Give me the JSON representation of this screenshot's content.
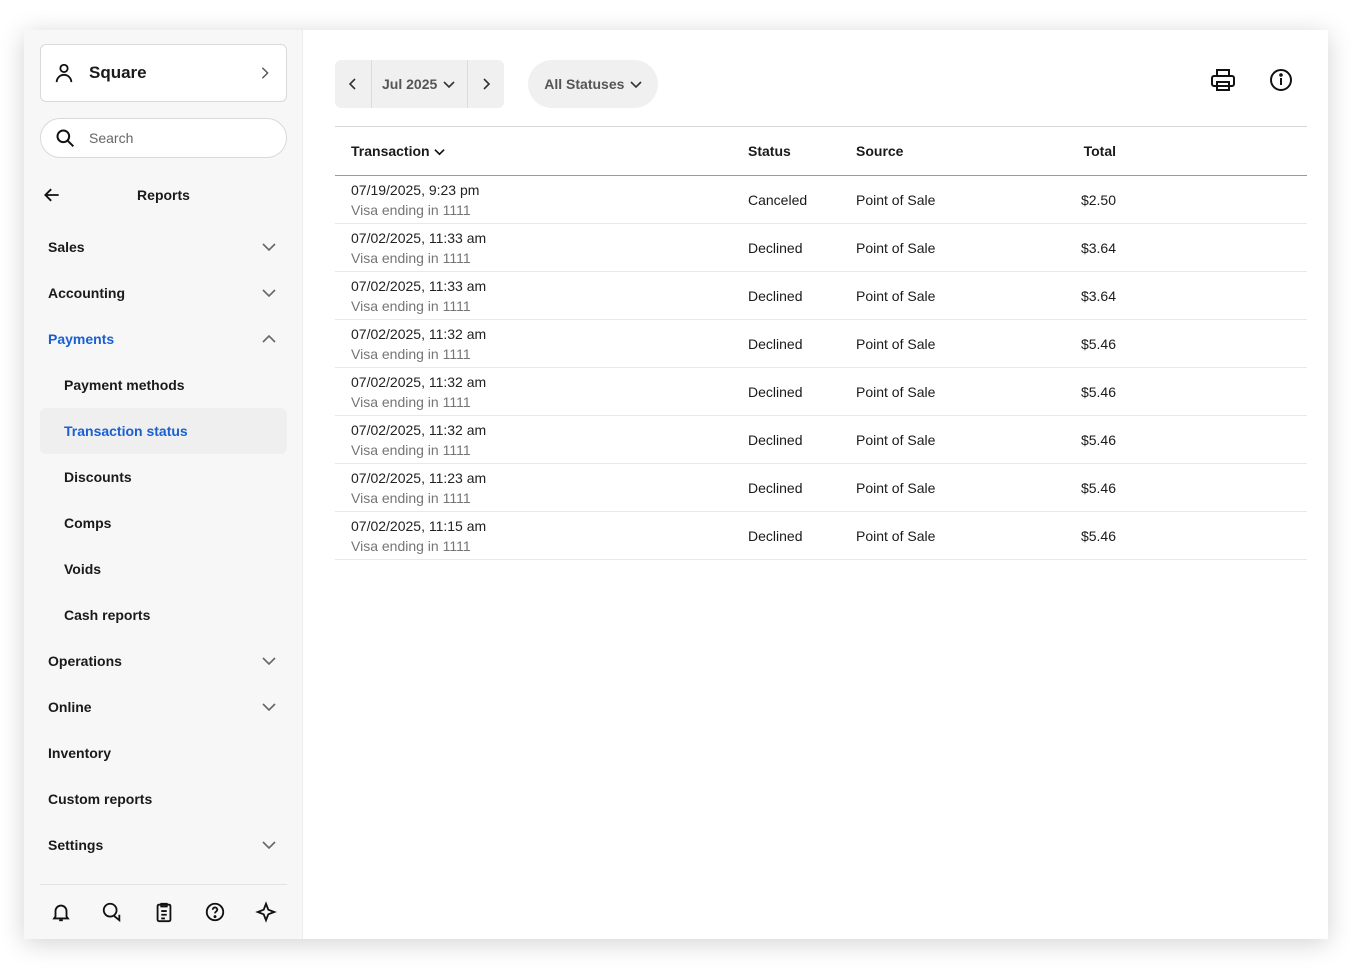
{
  "account": {
    "name": "Square"
  },
  "search": {
    "placeholder": "Search"
  },
  "sidebar": {
    "header": "Reports",
    "items": [
      {
        "label": "Sales"
      },
      {
        "label": "Accounting"
      },
      {
        "label": "Payments"
      },
      {
        "label": "Payment methods"
      },
      {
        "label": "Transaction status"
      },
      {
        "label": "Discounts"
      },
      {
        "label": "Comps"
      },
      {
        "label": "Voids"
      },
      {
        "label": "Cash reports"
      },
      {
        "label": "Operations"
      },
      {
        "label": "Online"
      },
      {
        "label": "Inventory"
      },
      {
        "label": "Custom reports"
      },
      {
        "label": "Settings"
      }
    ]
  },
  "toolbar": {
    "month": "Jul 2025",
    "status_filter": "All Statuses"
  },
  "table": {
    "headers": {
      "transaction": "Transaction",
      "status": "Status",
      "source": "Source",
      "total": "Total"
    },
    "rows": [
      {
        "datetime": "07/19/2025, 9:23 pm",
        "card": "Visa ending in 1111",
        "status": "Canceled",
        "source": "Point of Sale",
        "total": "$2.50"
      },
      {
        "datetime": "07/02/2025, 11:33 am",
        "card": "Visa ending in 1111",
        "status": "Declined",
        "source": "Point of Sale",
        "total": "$3.64"
      },
      {
        "datetime": "07/02/2025, 11:33 am",
        "card": "Visa ending in 1111",
        "status": "Declined",
        "source": "Point of Sale",
        "total": "$3.64"
      },
      {
        "datetime": "07/02/2025, 11:32 am",
        "card": "Visa ending in 1111",
        "status": "Declined",
        "source": "Point of Sale",
        "total": "$5.46"
      },
      {
        "datetime": "07/02/2025, 11:32 am",
        "card": "Visa ending in 1111",
        "status": "Declined",
        "source": "Point of Sale",
        "total": "$5.46"
      },
      {
        "datetime": "07/02/2025, 11:32 am",
        "card": "Visa ending in 1111",
        "status": "Declined",
        "source": "Point of Sale",
        "total": "$5.46"
      },
      {
        "datetime": "07/02/2025, 11:23 am",
        "card": "Visa ending in 1111",
        "status": "Declined",
        "source": "Point of Sale",
        "total": "$5.46"
      },
      {
        "datetime": "07/02/2025, 11:15 am",
        "card": "Visa ending in 1111",
        "status": "Declined",
        "source": "Point of Sale",
        "total": "$5.46"
      }
    ]
  },
  "colors": {
    "accent": "#1a5fd1",
    "sidebar_bg": "#f7f7f7",
    "muted_text": "#757575"
  }
}
